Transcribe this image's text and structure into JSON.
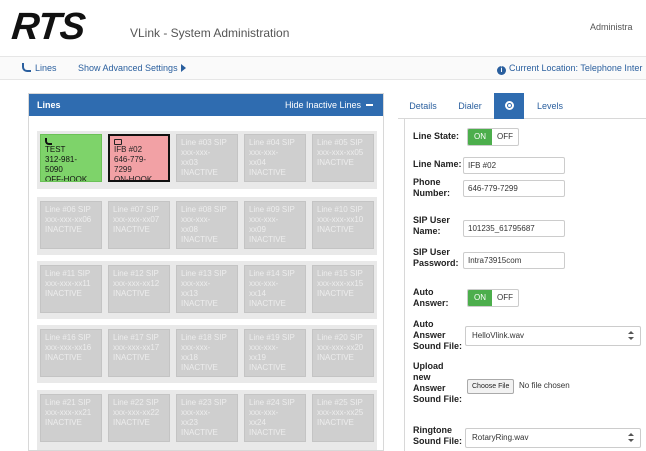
{
  "header": {
    "logo": "RTS",
    "title": "VLink - System Administration",
    "user_label": "Administra"
  },
  "toolbar": {
    "lines_link": "Lines",
    "advanced_link": "Show Advanced Settings",
    "location": "Current Location: Telephone Inter"
  },
  "lines_panel": {
    "title": "Lines",
    "hide_inactive": "Hide Inactive Lines",
    "groups": [
      {
        "tiles": [
          {
            "lines": [
              "TEST",
              "312-981-",
              "5090",
              "OFF-HOOK"
            ],
            "state": "green"
          },
          {
            "lines": [
              "IFB #02",
              "646-779-",
              "7299",
              "ON-HOOK"
            ],
            "state": "red"
          },
          {
            "lines": [
              "Line #03 SIP",
              "xxx-xxx-",
              "xx03",
              "INACTIVE"
            ],
            "state": "inactive"
          },
          {
            "lines": [
              "Line #04 SIP",
              "xxx-xxx-",
              "xx04",
              "INACTIVE"
            ],
            "state": "inactive"
          },
          {
            "lines": [
              "Line #05 SIP",
              "xxx-xxx-xx05",
              "INACTIVE"
            ],
            "state": "inactive"
          }
        ]
      },
      {
        "tiles": [
          {
            "lines": [
              "Line #06 SIP",
              "xxx-xxx-xx06",
              "INACTIVE"
            ],
            "state": "inactive"
          },
          {
            "lines": [
              "Line #07 SIP",
              "xxx-xxx-xx07",
              "INACTIVE"
            ],
            "state": "inactive"
          },
          {
            "lines": [
              "Line #08 SIP",
              "xxx-xxx-",
              "xx08",
              "INACTIVE"
            ],
            "state": "inactive"
          },
          {
            "lines": [
              "Line #09 SIP",
              "xxx-xxx-",
              "xx09",
              "INACTIVE"
            ],
            "state": "inactive"
          },
          {
            "lines": [
              "Line #10 SIP",
              "xxx-xxx-xx10",
              "INACTIVE"
            ],
            "state": "inactive"
          }
        ]
      },
      {
        "tiles": [
          {
            "lines": [
              "Line #11 SIP",
              "xxx-xxx-xx11",
              "INACTIVE"
            ],
            "state": "inactive"
          },
          {
            "lines": [
              "Line #12 SIP",
              "xxx-xxx-xx12",
              "INACTIVE"
            ],
            "state": "inactive"
          },
          {
            "lines": [
              "Line #13 SIP",
              "xxx-xxx-",
              "xx13",
              "INACTIVE"
            ],
            "state": "inactive"
          },
          {
            "lines": [
              "Line #14 SIP",
              "xxx-xxx-",
              "xx14",
              "INACTIVE"
            ],
            "state": "inactive"
          },
          {
            "lines": [
              "Line #15 SIP",
              "xxx-xxx-xx15",
              "INACTIVE"
            ],
            "state": "inactive"
          }
        ]
      },
      {
        "tiles": [
          {
            "lines": [
              "Line #16 SIP",
              "xxx-xxx-xx16",
              "INACTIVE"
            ],
            "state": "inactive"
          },
          {
            "lines": [
              "Line #17 SIP",
              "xxx-xxx-xx17",
              "INACTIVE"
            ],
            "state": "inactive"
          },
          {
            "lines": [
              "Line #18 SIP",
              "xxx-xxx-",
              "xx18",
              "INACTIVE"
            ],
            "state": "inactive"
          },
          {
            "lines": [
              "Line #19 SIP",
              "xxx-xxx-",
              "xx19",
              "INACTIVE"
            ],
            "state": "inactive"
          },
          {
            "lines": [
              "Line #20 SIP",
              "xxx-xxx-xx20",
              "INACTIVE"
            ],
            "state": "inactive"
          }
        ]
      },
      {
        "tiles": [
          {
            "lines": [
              "Line #21 SIP",
              "xxx-xxx-xx21",
              "INACTIVE"
            ],
            "state": "inactive"
          },
          {
            "lines": [
              "Line #22 SIP",
              "xxx-xxx-xx22",
              "INACTIVE"
            ],
            "state": "inactive"
          },
          {
            "lines": [
              "Line #23 SIP",
              "xxx-xxx-",
              "xx23",
              "INACTIVE"
            ],
            "state": "inactive"
          },
          {
            "lines": [
              "Line #24 SIP",
              "xxx-xxx-",
              "xx24",
              "INACTIVE"
            ],
            "state": "inactive"
          },
          {
            "lines": [
              "Line #25 SIP",
              "xxx-xxx-xx25",
              "INACTIVE"
            ],
            "state": "inactive"
          }
        ]
      }
    ]
  },
  "tabs": {
    "details": "Details",
    "dialer": "Dialer",
    "levels": "Levels"
  },
  "settings": {
    "line_state_label": "Line State:",
    "on": "ON",
    "off": "OFF",
    "line_name_label": "Line Name:",
    "line_name_value": "IFB #02",
    "phone_label_1": "Phone",
    "phone_label_2": "Number:",
    "phone_value": "646-779-7299",
    "sip_user_label_1": "SIP User",
    "sip_user_label_2": "Name:",
    "sip_user_value": "101235_61795687",
    "sip_pass_label_1": "SIP User",
    "sip_pass_label_2": "Password:",
    "sip_pass_value": "Intra73915com",
    "auto_answer_label_1": "Auto",
    "auto_answer_label_2": "Answer:",
    "auto_sound_label_1": "Auto",
    "auto_sound_label_2": "Answer",
    "auto_sound_label_3": "Sound File:",
    "auto_sound_value": "HelloVlink.wav",
    "upload_label_1": "Upload",
    "upload_label_2": "new",
    "upload_label_3": "Answer",
    "upload_label_4": "Sound File:",
    "choose_file": "Choose File",
    "no_file": "No file chosen",
    "ringtone_label_1": "Ringtone",
    "ringtone_label_2": "Sound File:",
    "ringtone_value": "RotaryRing.wav"
  },
  "colors": {
    "accent": "#2f6cb0",
    "online": "#7ed36a",
    "onhook": "#f2a1a5",
    "toggle_on": "#4cae4c"
  }
}
